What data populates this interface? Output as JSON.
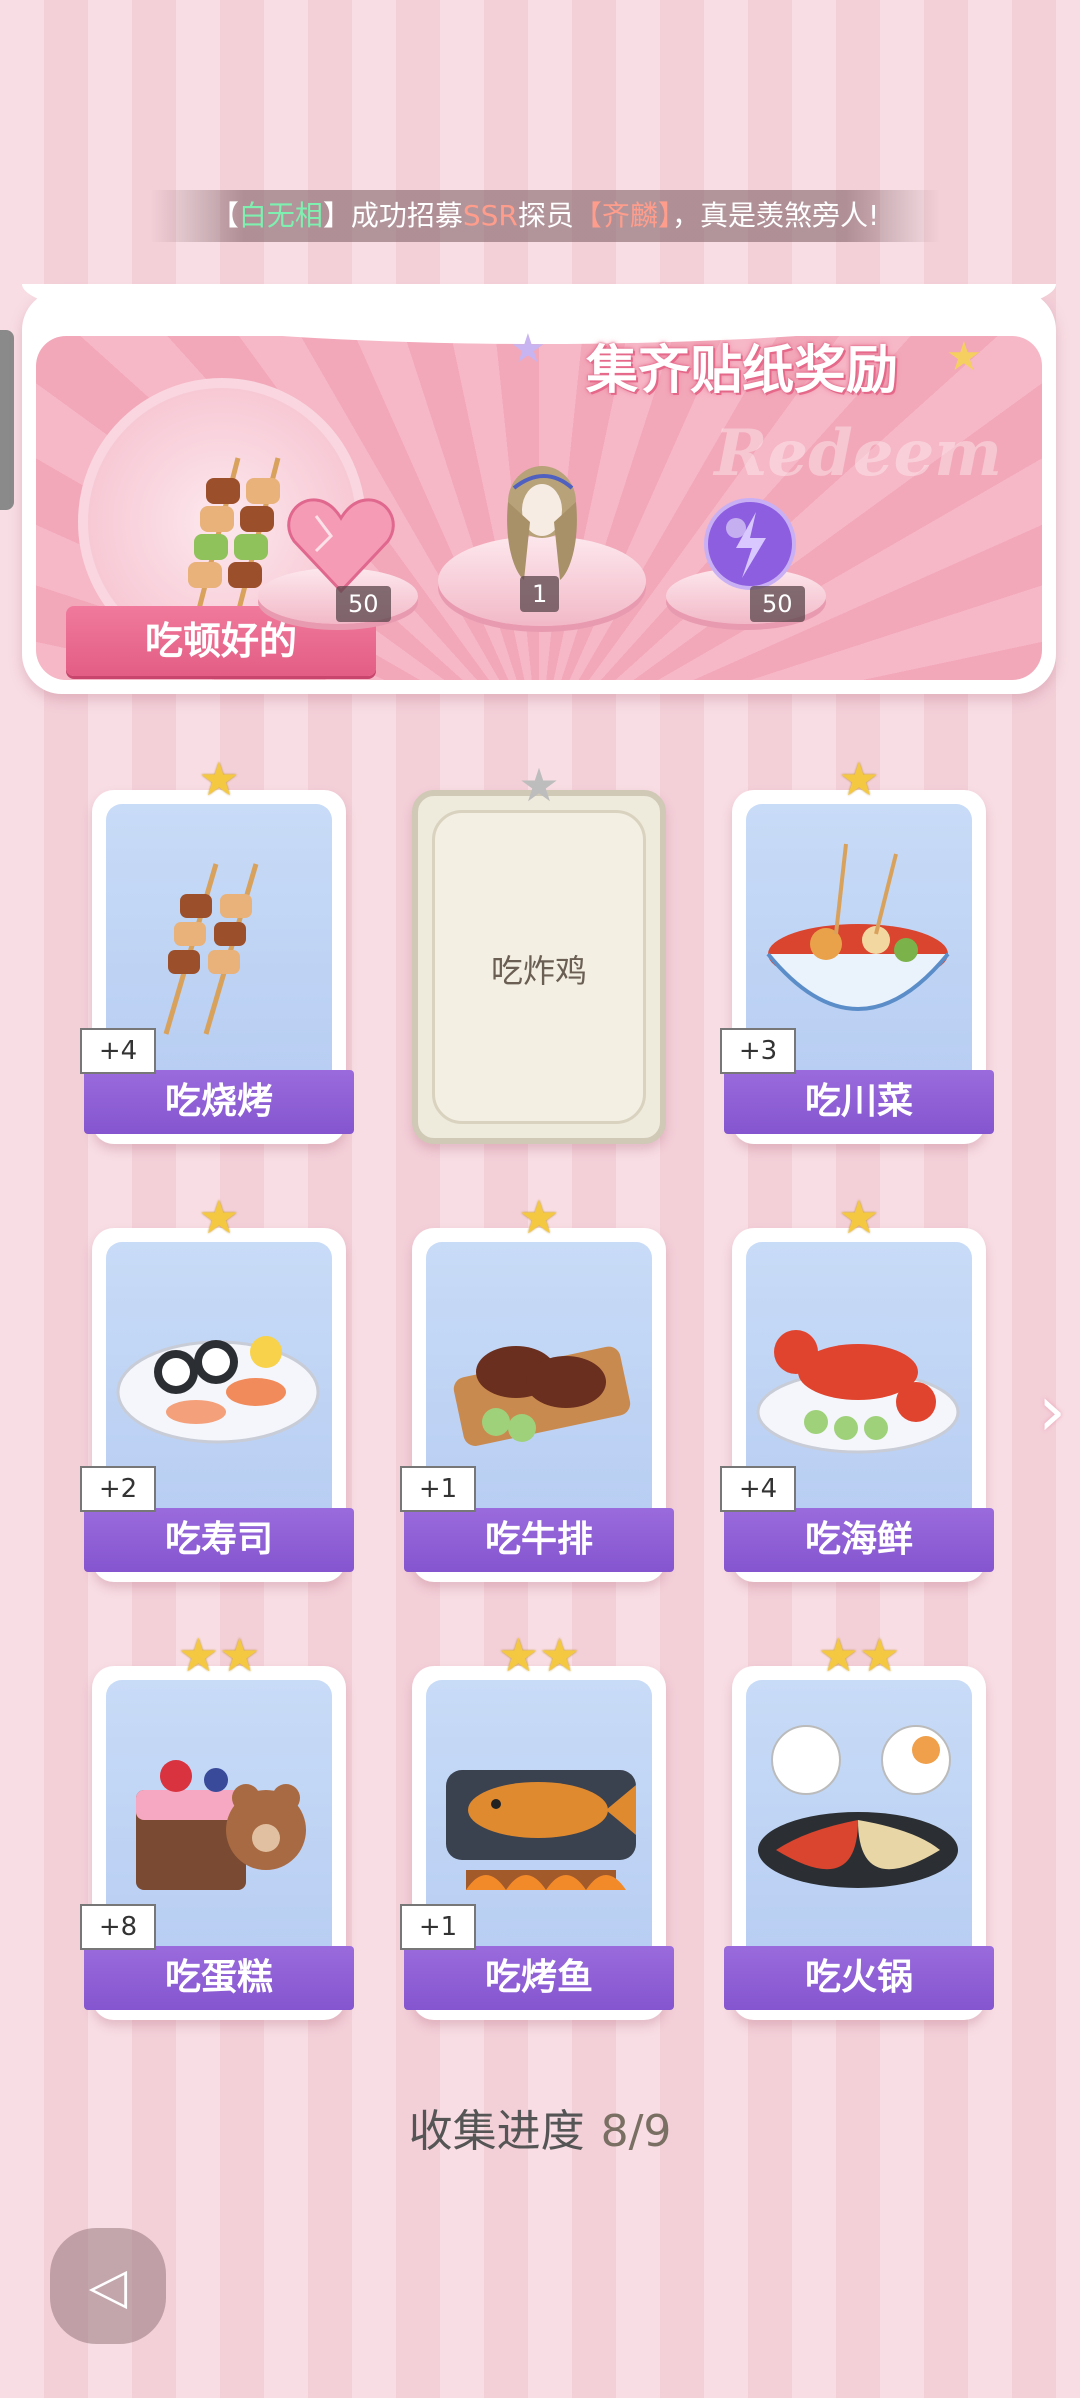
{
  "ticker": {
    "lead": "【",
    "name1": "白无相",
    "mid1": "】成功招募",
    "rarity": "SSR",
    "mid2": "探员",
    "name2_open": "【",
    "name2": "齐麟",
    "name2_close": "】",
    "tail": "，真是羡煞旁人!"
  },
  "reward": {
    "title": "集齐贴纸奖励",
    "bg_word": "Redeem",
    "badge_label": "吃顿好的",
    "items": [
      {
        "icon": "heart-gem-icon",
        "count": "50"
      },
      {
        "icon": "hairstyle-icon",
        "count": "1"
      },
      {
        "icon": "energy-orb-icon",
        "count": "50"
      }
    ]
  },
  "cards": [
    {
      "label": "吃烧烤",
      "bonus": "+4",
      "stars": 1,
      "icon": "bbq-skewer-icon",
      "locked": false
    },
    {
      "label": "吃炸鸡",
      "bonus": "",
      "stars": 1,
      "icon": "locked-card-icon",
      "locked": true
    },
    {
      "label": "吃川菜",
      "bonus": "+3",
      "stars": 1,
      "icon": "spicy-soup-icon",
      "locked": false
    },
    {
      "label": "吃寿司",
      "bonus": "+2",
      "stars": 1,
      "icon": "sushi-icon",
      "locked": false
    },
    {
      "label": "吃牛排",
      "bonus": "+1",
      "stars": 1,
      "icon": "steak-icon",
      "locked": false
    },
    {
      "label": "吃海鲜",
      "bonus": "+4",
      "stars": 1,
      "icon": "lobster-icon",
      "locked": false
    },
    {
      "label": "吃蛋糕",
      "bonus": "+8",
      "stars": 2,
      "icon": "cake-icon",
      "locked": false
    },
    {
      "label": "吃烤鱼",
      "bonus": "+1",
      "stars": 2,
      "icon": "roast-fish-icon",
      "locked": false
    },
    {
      "label": "吃火锅",
      "bonus": "",
      "stars": 2,
      "icon": "hotpot-icon",
      "locked": false
    }
  ],
  "progress": {
    "label": "收集进度",
    "value": "8/9"
  },
  "colors": {
    "card_label": "#8455cf",
    "accent_pink": "#e35d84",
    "star": "#f5c842"
  }
}
